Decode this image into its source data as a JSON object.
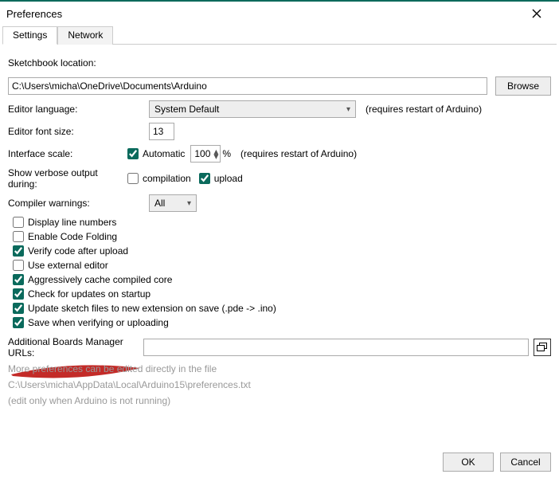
{
  "window": {
    "title": "Preferences"
  },
  "tabs": {
    "settings": "Settings",
    "network": "Network"
  },
  "labels": {
    "sketchLoc": "Sketchbook location:",
    "browse": "Browse",
    "editorLang": "Editor language:",
    "langHint": "(requires restart of Arduino)",
    "fontSize": "Editor font size:",
    "ifaceScale": "Interface scale:",
    "automatic": "Automatic",
    "percent": "%",
    "scaleHint": "(requires restart of Arduino)",
    "verbose": "Show verbose output during:",
    "compilation": "compilation",
    "upload": "upload",
    "compilerWarn": "Compiler warnings:",
    "displayLineNums": "Display line numbers",
    "codeFolding": "Enable Code Folding",
    "verifyUpload": "Verify code after upload",
    "externalEditor": "Use external editor",
    "aggCache": "Aggressively cache compiled core",
    "checkUpdates": "Check for updates on startup",
    "updateExt": "Update sketch files to new extension on save (.pde -> .ino)",
    "saveVerify": "Save when verifying or uploading",
    "boardsUrl": "Additional Boards Manager URLs:",
    "moreFoot1": "More preferences can be edited directly in the file",
    "moreFoot2": "C:\\Users\\micha\\AppData\\Local\\Arduino15\\preferences.txt",
    "moreFoot3": "(edit only when Arduino is not running)",
    "ok": "OK",
    "cancel": "Cancel"
  },
  "values": {
    "sketchPath": "C:\\Users\\micha\\OneDrive\\Documents\\Arduino",
    "language": "System Default",
    "fontSize": "13",
    "scale": "100",
    "compilerWarn": "All",
    "boardsUrl": ""
  },
  "checks": {
    "automatic": true,
    "compilation": false,
    "upload": true,
    "displayLineNums": false,
    "codeFolding": false,
    "verifyUpload": true,
    "externalEditor": false,
    "aggCache": true,
    "checkUpdates": true,
    "updateExt": true,
    "saveVerify": true
  }
}
